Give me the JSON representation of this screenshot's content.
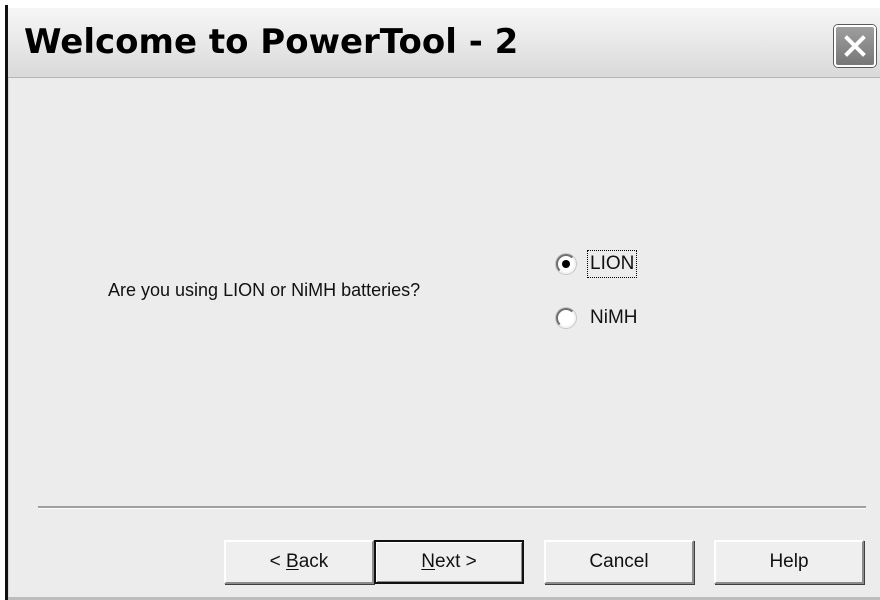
{
  "window": {
    "title": "Welcome to PowerTool - 2"
  },
  "content": {
    "question": "Are you using LION or NiMH batteries?",
    "options": [
      {
        "label": "LION",
        "selected": true
      },
      {
        "label": "NiMH",
        "selected": false
      }
    ]
  },
  "buttons": {
    "back": {
      "prefix": "< ",
      "mnemonic": "B",
      "rest": "ack"
    },
    "next": {
      "mnemonic": "N",
      "rest": "ext >"
    },
    "cancel": "Cancel",
    "help": "Help"
  },
  "icons": {
    "close": "close-icon",
    "radio_selected": "radio-selected-icon",
    "radio_unselected": "radio-unselected-icon"
  },
  "colors": {
    "window_background": "#ececec",
    "title_text": "#000000",
    "close_button": "#808080"
  }
}
